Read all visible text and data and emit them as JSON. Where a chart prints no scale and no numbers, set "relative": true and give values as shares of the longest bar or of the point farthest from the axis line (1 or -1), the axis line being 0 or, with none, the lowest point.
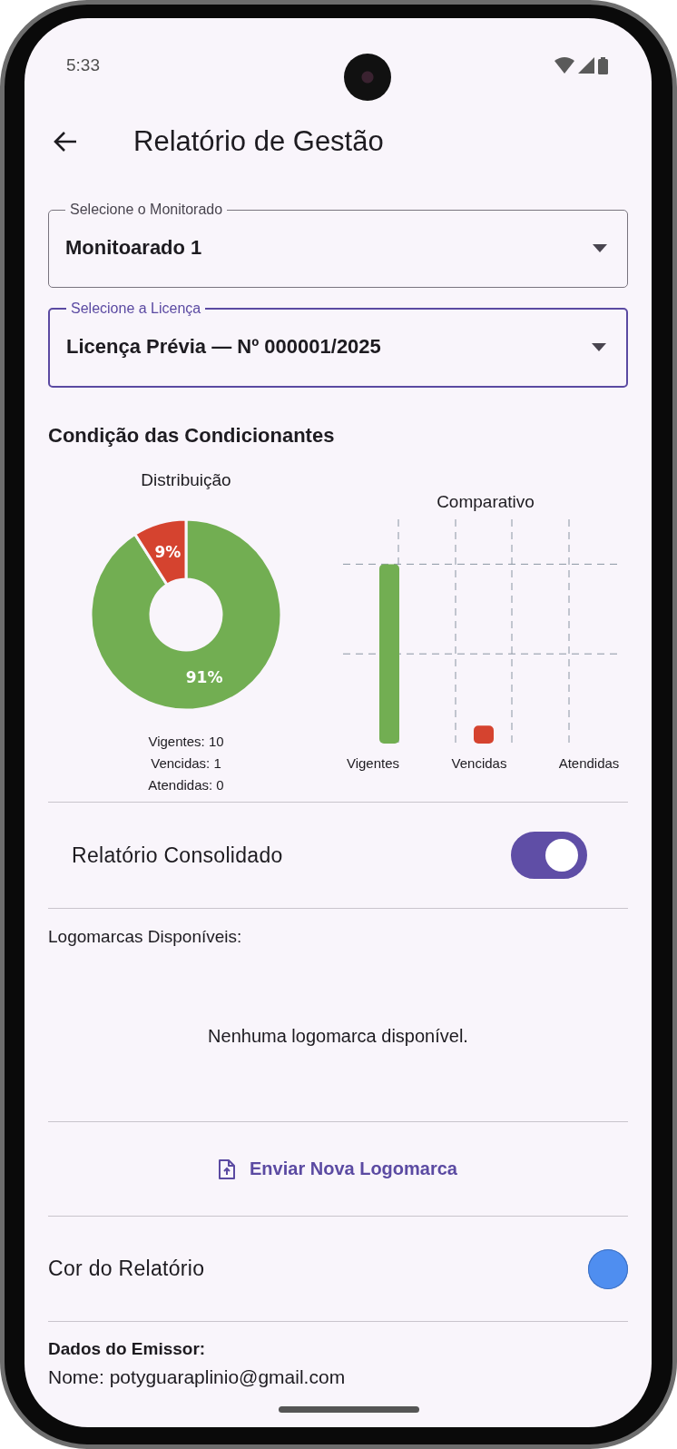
{
  "status_bar": {
    "time": "5:33"
  },
  "app_bar": {
    "title": "Relatório de Gestão"
  },
  "fields": [
    {
      "label": "Selecione o Monitorado",
      "value": "Monitoarado 1",
      "focused": false
    },
    {
      "label": "Selecione a Licença",
      "value": "Licença Prévia — Nº 000001/2025",
      "focused": true
    }
  ],
  "conditions": {
    "title": "Condição das Condicionantes",
    "distribution": {
      "chart_data": {
        "type": "donut",
        "title": "Distribuição",
        "values": [
          91,
          9
        ],
        "colors": [
          "#72ae52",
          "#d5432f"
        ],
        "value_labels": [
          "91%",
          "9%"
        ]
      },
      "legend": [
        "Vigentes: 10",
        "Vencidas: 1",
        "Atendidas: 0"
      ]
    },
    "comparison": {
      "chart_data": {
        "type": "bar",
        "title": "Comparativo",
        "categories": [
          "Vigentes",
          "Vencidas",
          "Atendidas"
        ],
        "values": [
          1,
          0.1,
          0
        ],
        "colors": [
          "#72ae52",
          "#d5432f",
          "#7f8fa0"
        ],
        "relative": true
      }
    }
  },
  "consolidated": {
    "label": "Relatório Consolidado",
    "on": true
  },
  "logos": {
    "title": "Logomarcas Disponíveis:",
    "empty_text": "Nenhuma logomarca disponível."
  },
  "upload_button": {
    "label": "Enviar Nova Logomarca"
  },
  "report_color": {
    "label": "Cor do Relatório",
    "color": "#4f8ef0"
  },
  "issuer": {
    "title": "Dados do Emissor:",
    "lines": [
      "Nome: potyguaraplinio@gmail.com"
    ]
  }
}
